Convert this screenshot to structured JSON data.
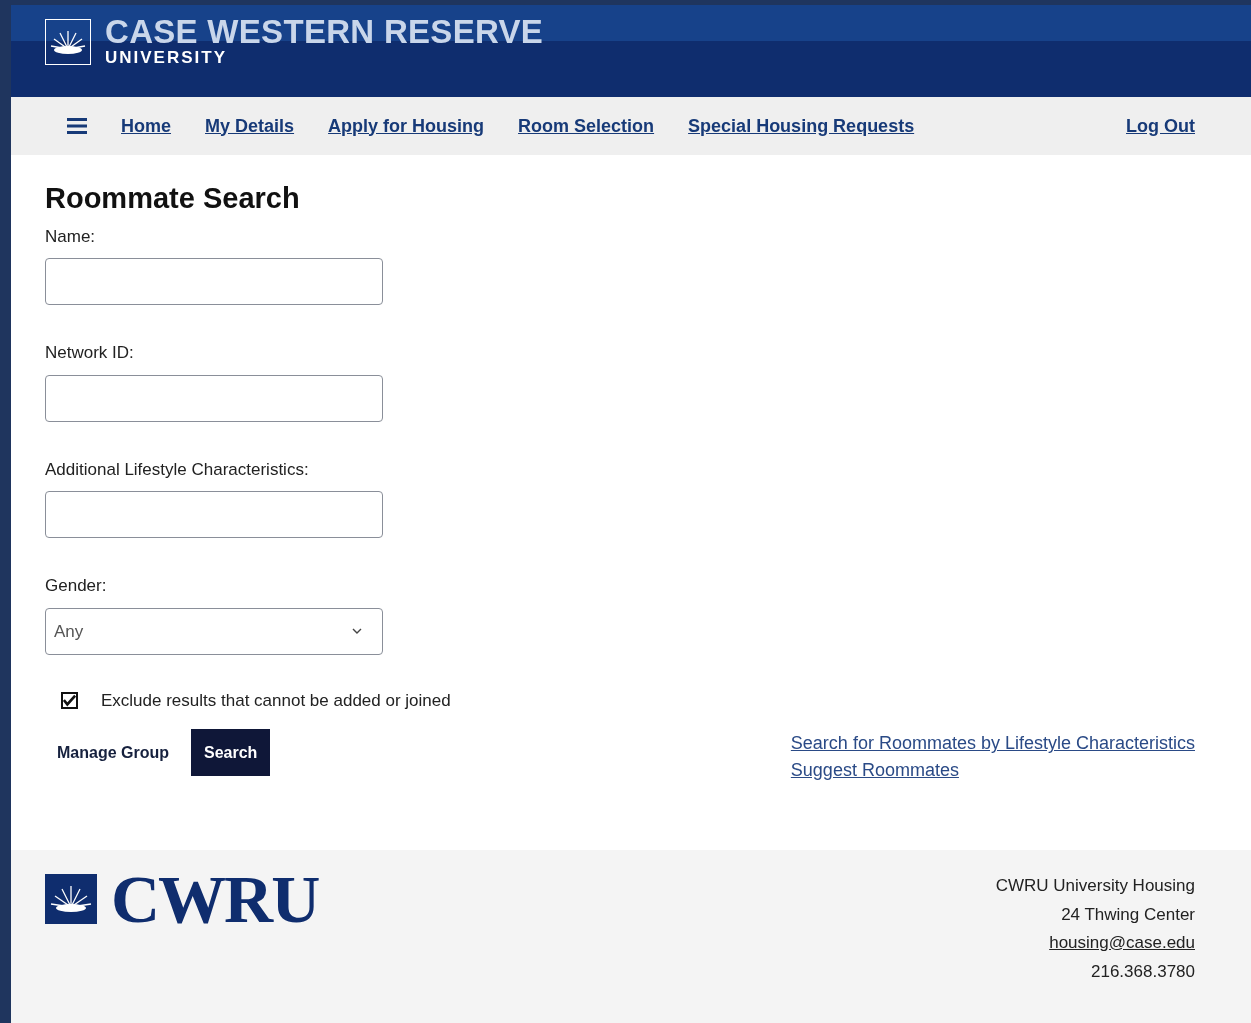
{
  "header": {
    "title": "CASE WESTERN RESERVE",
    "subtitle": "UNIVERSITY"
  },
  "nav": {
    "items": [
      {
        "label": "Home"
      },
      {
        "label": "My Details"
      },
      {
        "label": "Apply for Housing"
      },
      {
        "label": "Room Selection"
      },
      {
        "label": "Special Housing Requests"
      }
    ],
    "logout": "Log Out"
  },
  "page_title": "Roommate Search",
  "fields": [
    {
      "kind": "text",
      "label": "Name:"
    },
    {
      "kind": "text",
      "label": "Network ID:"
    },
    {
      "kind": "text",
      "label": "Additional Lifestyle Characteristics:"
    },
    {
      "kind": "select",
      "label": "Gender:",
      "value": "Any"
    }
  ],
  "exclude": {
    "label": "Exclude results that cannot be added or joined",
    "checked": true
  },
  "buttons": [
    {
      "kind": "link",
      "label": "Manage Group"
    },
    {
      "kind": "primary",
      "label": "Search"
    }
  ],
  "links": [
    {
      "label": "Search for Roommates by Lifestyle Characteristics"
    },
    {
      "label": "Suggest Roommates"
    }
  ],
  "footer": {
    "logo_text": "CWRU",
    "address": [
      {
        "kind": "text",
        "text": "CWRU University Housing"
      },
      {
        "kind": "text",
        "text": "24 Thwing Center"
      },
      {
        "kind": "link",
        "text": "housing@case.edu"
      },
      {
        "kind": "text",
        "text": "216.368.3780"
      }
    ]
  }
}
